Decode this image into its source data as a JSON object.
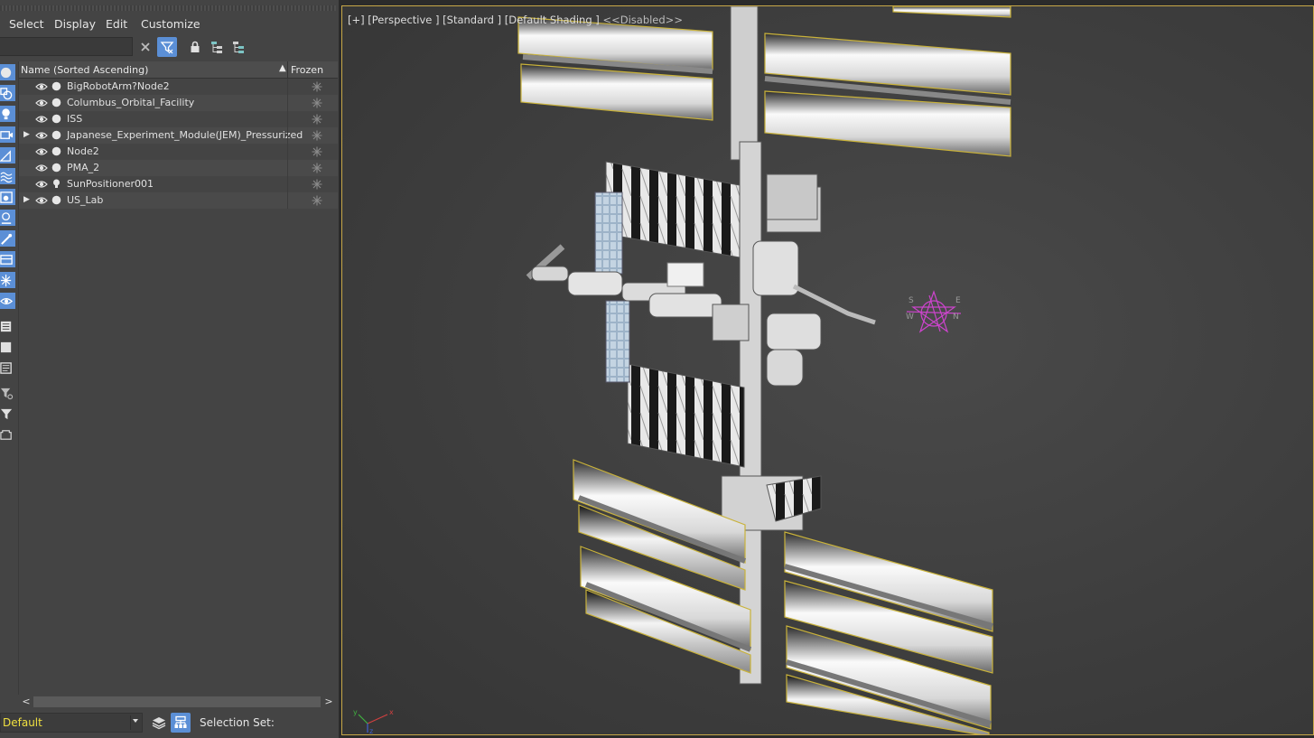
{
  "menu": [
    "Select",
    "Display",
    "Edit",
    "Customize"
  ],
  "search": {
    "value": ""
  },
  "list": {
    "column_name": "Name (Sorted Ascending)",
    "column_frozen": "Frozen",
    "rows": [
      {
        "label": "BigRobotArm?Node2",
        "expandable": false,
        "icon": "geometry-icon"
      },
      {
        "label": "Columbus_Orbital_Facility",
        "expandable": false,
        "icon": "geometry-icon"
      },
      {
        "label": "ISS",
        "expandable": false,
        "icon": "geometry-icon"
      },
      {
        "label": "Japanese_Experiment_Module(JEM)_Pressurized",
        "expandable": true,
        "icon": "geometry-icon"
      },
      {
        "label": "Node2",
        "expandable": false,
        "icon": "geometry-icon"
      },
      {
        "label": "PMA_2",
        "expandable": false,
        "icon": "geometry-icon"
      },
      {
        "label": "SunPositioner001",
        "expandable": false,
        "icon": "light-icon"
      },
      {
        "label": "US_Lab",
        "expandable": true,
        "icon": "geometry-icon"
      }
    ]
  },
  "bottom": {
    "layer": "Default",
    "selection_set_label": "Selection Set:"
  },
  "viewport": {
    "label_parts": [
      "[+]",
      "[Perspective ]",
      "[Standard ]",
      "[Default Shading ]",
      "<<Disabled>>"
    ],
    "compass_letters": [
      "S",
      "E",
      "W",
      "N"
    ],
    "axes": [
      "x",
      "y",
      "z"
    ]
  },
  "colors": {
    "accent": "#5b8fd6",
    "frozen_star": "#8a8a8a",
    "layer_text": "#f0e040",
    "viewport_border": "#c8a848",
    "helper": "#cc44cc"
  }
}
